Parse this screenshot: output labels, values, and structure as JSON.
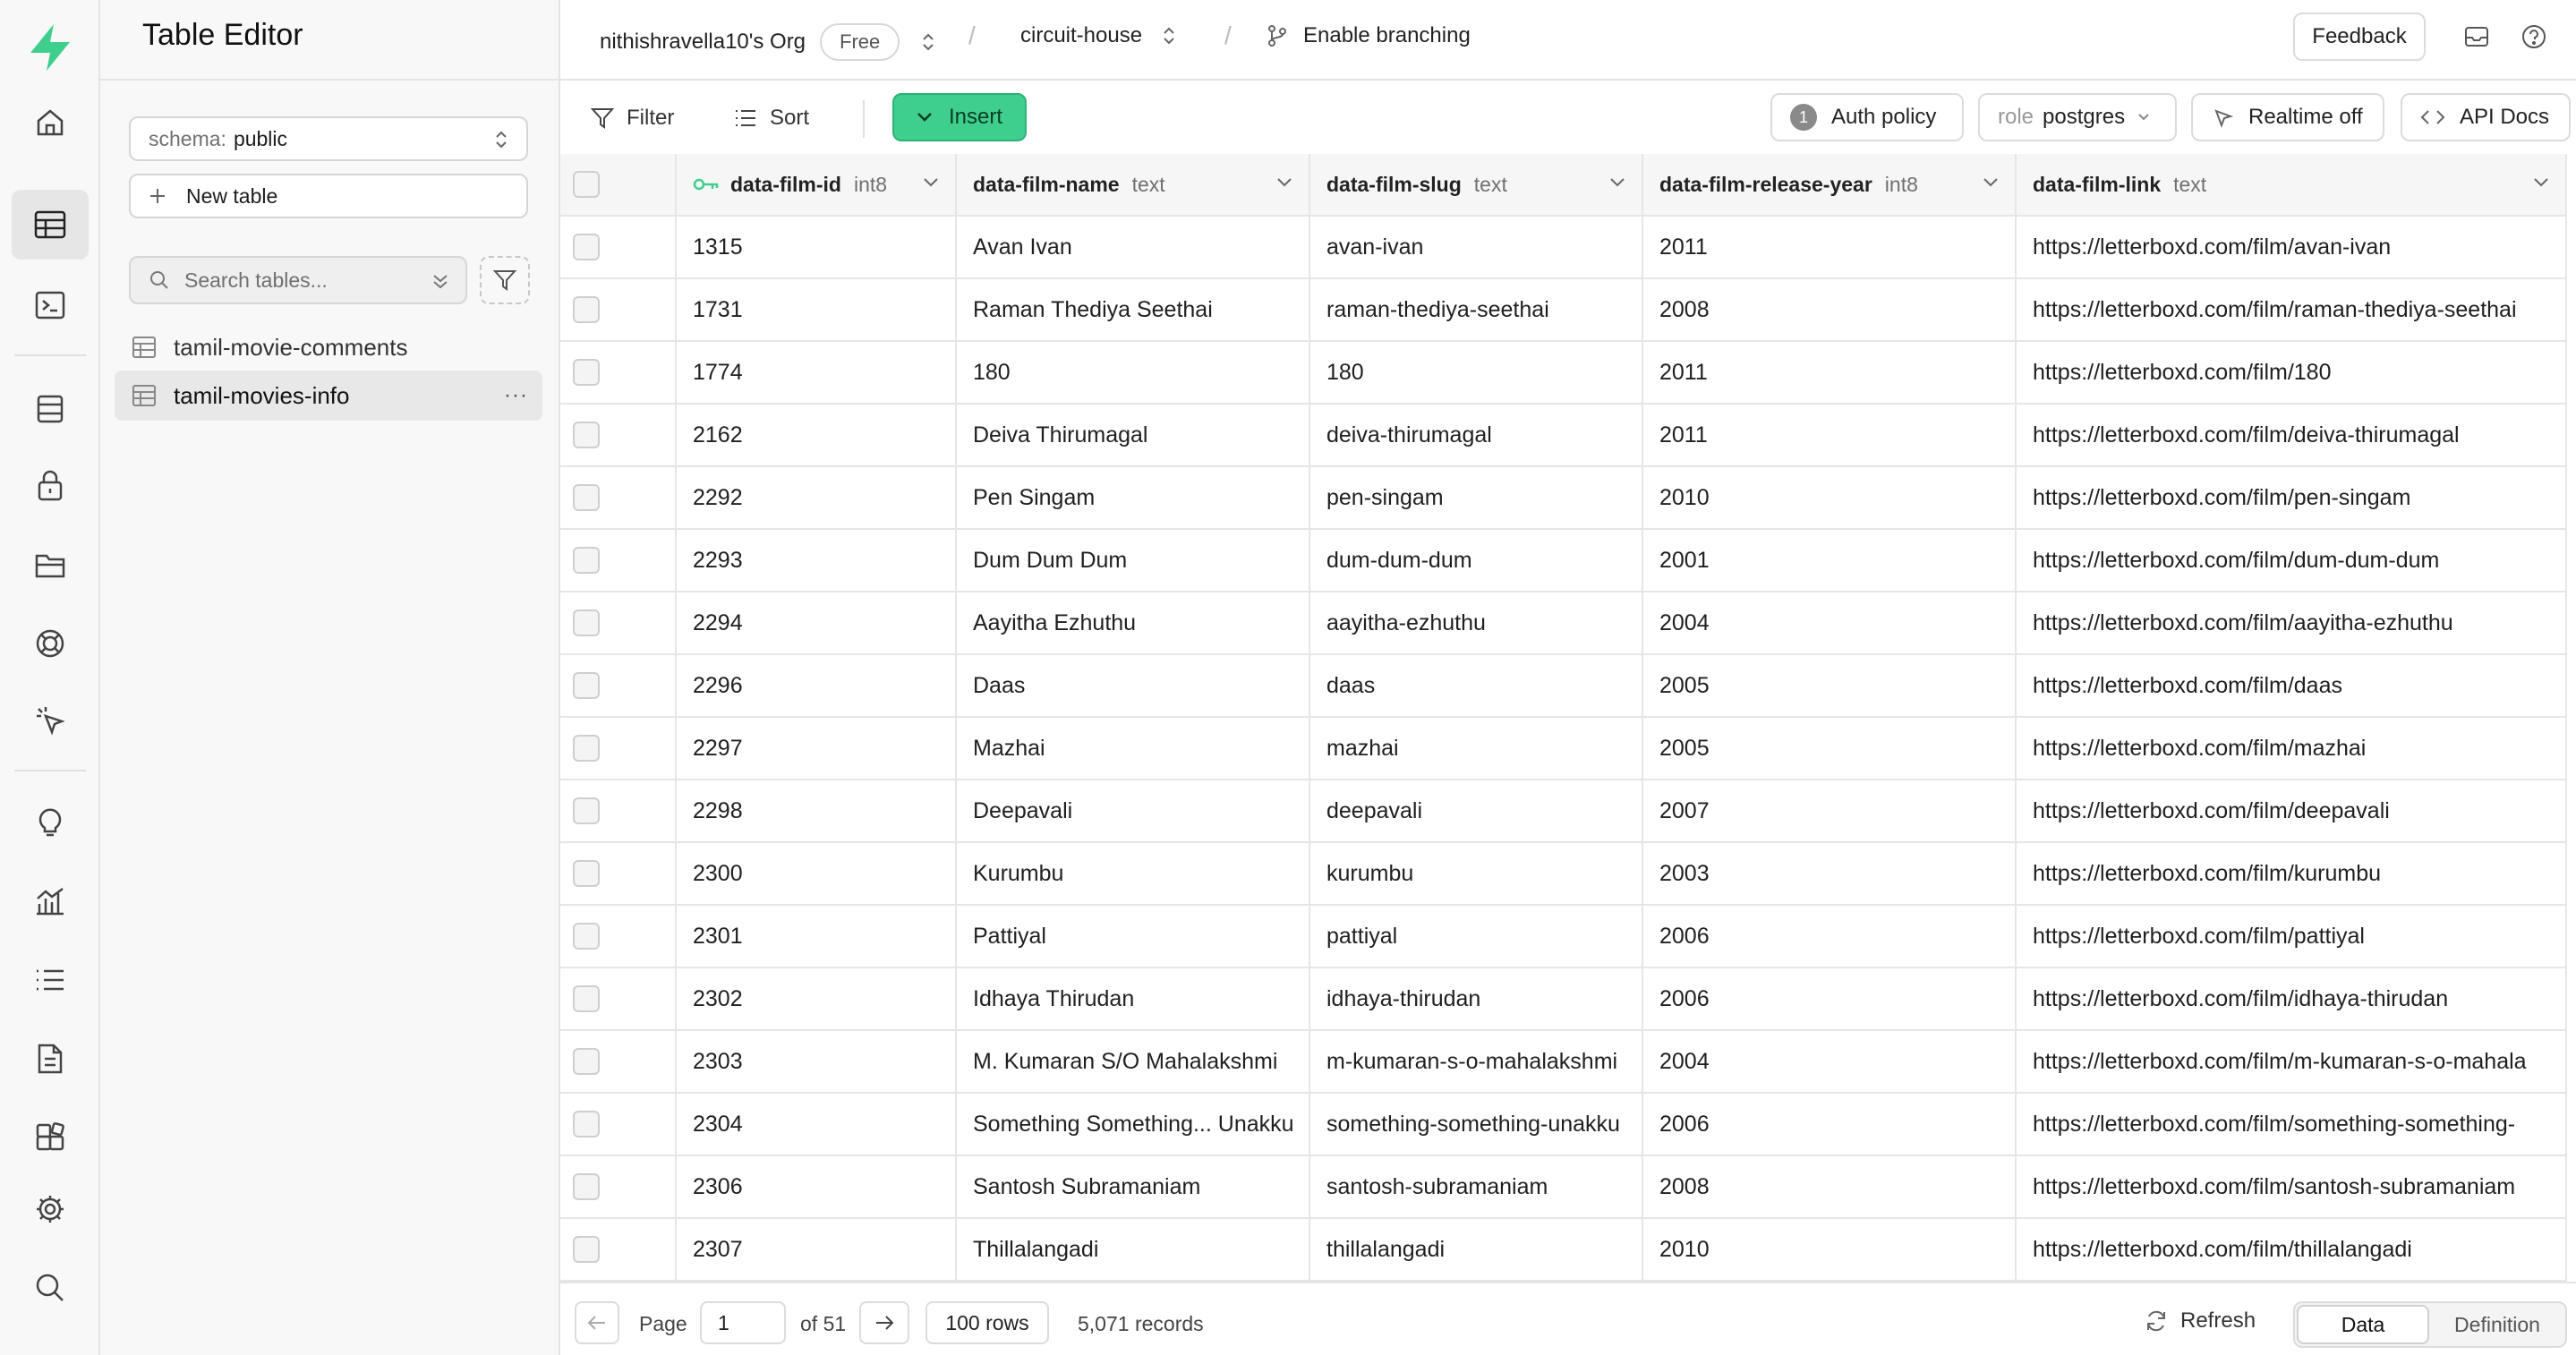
{
  "app": {
    "title": "Table Editor"
  },
  "nav_rail": [
    {
      "name": "home-icon"
    },
    {
      "name": "table-editor-icon",
      "active": true
    },
    {
      "name": "sql-editor-icon"
    },
    {
      "name": "database-icon"
    },
    {
      "name": "auth-icon"
    },
    {
      "name": "storage-icon"
    },
    {
      "name": "realtime-icon"
    },
    {
      "name": "edge-functions-icon"
    },
    {
      "name": "advisors-icon"
    },
    {
      "name": "reports-icon"
    },
    {
      "name": "logs-icon"
    },
    {
      "name": "api-docs-icon"
    },
    {
      "name": "integrations-icon"
    },
    {
      "name": "settings-icon"
    },
    {
      "name": "search-icon"
    }
  ],
  "sidebar": {
    "schema_prefix": "schema:",
    "schema_value": "public",
    "new_table": "New table",
    "search_placeholder": "Search tables...",
    "tables": [
      {
        "label": "tamil-movie-comments",
        "active": false
      },
      {
        "label": "tamil-movies-info",
        "active": true
      }
    ],
    "more": "···"
  },
  "topbar": {
    "org": "nithishravella10's Org",
    "plan": "Free",
    "project": "circuit-house",
    "branching": "Enable branching",
    "feedback": "Feedback"
  },
  "toolbar": {
    "filter": "Filter",
    "sort": "Sort",
    "insert": "Insert",
    "auth_count": "1",
    "auth_policy": "Auth policy",
    "role_prefix": "role",
    "role_value": "postgres",
    "realtime": "Realtime off",
    "api_docs": "API Docs"
  },
  "grid": {
    "columns": [
      {
        "name": "data-film-id",
        "type": "int8",
        "key": true
      },
      {
        "name": "data-film-name",
        "type": "text"
      },
      {
        "name": "data-film-slug",
        "type": "text"
      },
      {
        "name": "data-film-release-year",
        "type": "int8"
      },
      {
        "name": "data-film-link",
        "type": "text"
      }
    ],
    "rows": [
      [
        "1315",
        "Avan Ivan",
        "avan-ivan",
        "2011",
        "https://letterboxd.com/film/avan-ivan"
      ],
      [
        "1731",
        "Raman Thediya Seethai",
        "raman-thediya-seethai",
        "2008",
        "https://letterboxd.com/film/raman-thediya-seethai"
      ],
      [
        "1774",
        "180",
        "180",
        "2011",
        "https://letterboxd.com/film/180"
      ],
      [
        "2162",
        "Deiva Thirumagal",
        "deiva-thirumagal",
        "2011",
        "https://letterboxd.com/film/deiva-thirumagal"
      ],
      [
        "2292",
        "Pen Singam",
        "pen-singam",
        "2010",
        "https://letterboxd.com/film/pen-singam"
      ],
      [
        "2293",
        "Dum Dum Dum",
        "dum-dum-dum",
        "2001",
        "https://letterboxd.com/film/dum-dum-dum"
      ],
      [
        "2294",
        "Aayitha Ezhuthu",
        "aayitha-ezhuthu",
        "2004",
        "https://letterboxd.com/film/aayitha-ezhuthu"
      ],
      [
        "2296",
        "Daas",
        "daas",
        "2005",
        "https://letterboxd.com/film/daas"
      ],
      [
        "2297",
        "Mazhai",
        "mazhai",
        "2005",
        "https://letterboxd.com/film/mazhai"
      ],
      [
        "2298",
        "Deepavali",
        "deepavali",
        "2007",
        "https://letterboxd.com/film/deepavali"
      ],
      [
        "2300",
        "Kurumbu",
        "kurumbu",
        "2003",
        "https://letterboxd.com/film/kurumbu"
      ],
      [
        "2301",
        "Pattiyal",
        "pattiyal",
        "2006",
        "https://letterboxd.com/film/pattiyal"
      ],
      [
        "2302",
        "Idhaya Thirudan",
        "idhaya-thirudan",
        "2006",
        "https://letterboxd.com/film/idhaya-thirudan"
      ],
      [
        "2303",
        "M. Kumaran S/O Mahalakshmi",
        "m-kumaran-s-o-mahalakshmi",
        "2004",
        "https://letterboxd.com/film/m-kumaran-s-o-mahala"
      ],
      [
        "2304",
        "Something Something... Unakku",
        "something-something-unakku",
        "2006",
        "https://letterboxd.com/film/something-something-"
      ],
      [
        "2306",
        "Santosh Subramaniam",
        "santosh-subramaniam",
        "2008",
        "https://letterboxd.com/film/santosh-subramaniam"
      ],
      [
        "2307",
        "Thillalangadi",
        "thillalangadi",
        "2010",
        "https://letterboxd.com/film/thillalangadi"
      ],
      [
        "",
        "",
        "",
        "",
        ""
      ]
    ]
  },
  "footer": {
    "page_label": "Page",
    "page_value": "1",
    "page_total": "of 51",
    "rows_per_page": "100 rows",
    "records": "5,071 records",
    "refresh": "Refresh",
    "view_data": "Data",
    "view_definition": "Definition"
  },
  "colors": {
    "brand": "#3ecf8e",
    "brand_border": "#2bb377"
  }
}
